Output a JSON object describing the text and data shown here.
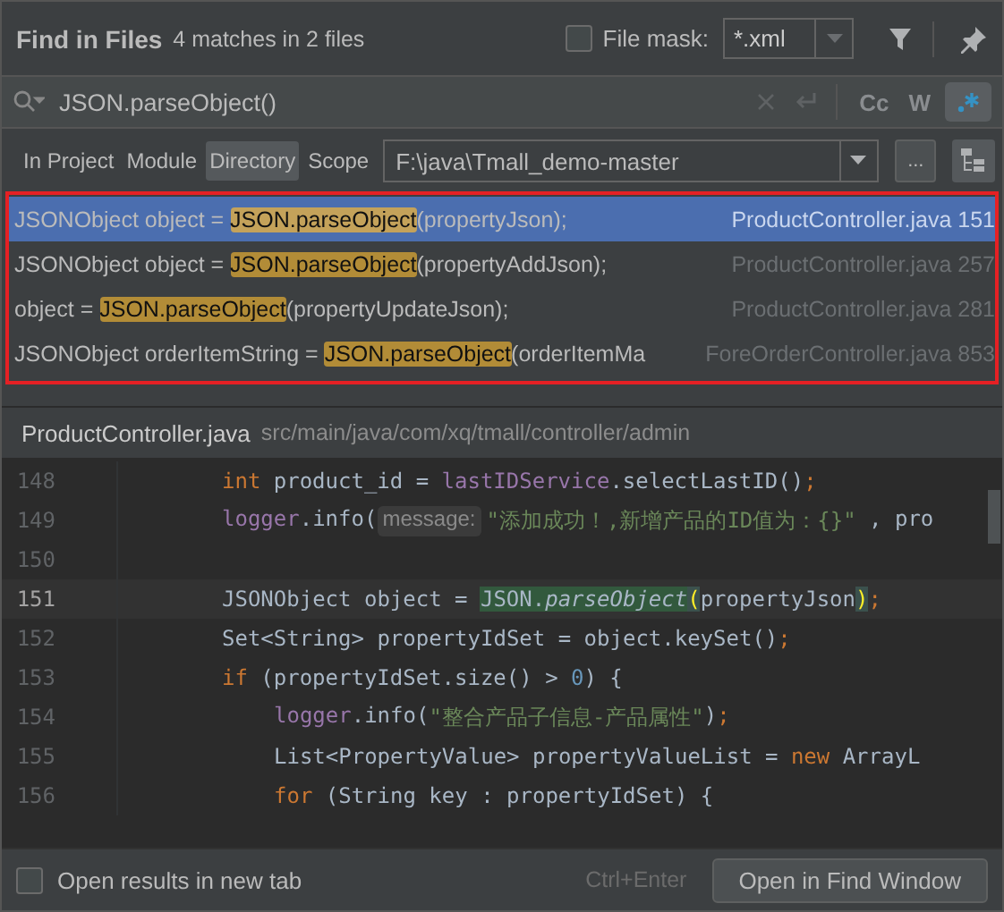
{
  "header": {
    "title": "Find in Files",
    "summary": "4 matches in 2 files",
    "file_mask": {
      "label": "File mask:",
      "checked": false,
      "value": "*.xml"
    }
  },
  "search": {
    "value": "JSON.parseObject()",
    "regex_on": true,
    "case_label": "Cc",
    "words_label": "W"
  },
  "scopes": [
    {
      "label": "In Project",
      "selected": false
    },
    {
      "label": "Module",
      "selected": false
    },
    {
      "label": "Directory",
      "selected": true
    },
    {
      "label": "Scope",
      "selected": false
    }
  ],
  "directory": {
    "value": "F:\\java\\Tmall_demo-master",
    "browse_label": "..."
  },
  "results": [
    {
      "before": "JSONObject object = ",
      "match": "JSON.parseObject",
      "after": "(propertyJson);",
      "file": "ProductController.java",
      "line": "151",
      "selected": true
    },
    {
      "before": "JSONObject object = ",
      "match": "JSON.parseObject",
      "after": "(propertyAddJson);",
      "file": "ProductController.java",
      "line": "257",
      "selected": false
    },
    {
      "before": "object = ",
      "match": "JSON.parseObject",
      "after": "(propertyUpdateJson);",
      "file": "ProductController.java",
      "line": "281",
      "selected": false
    },
    {
      "before": "JSONObject orderItemString = ",
      "match": "JSON.parseObject",
      "after": "(orderItemMa",
      "file": "ForeOrderController.java",
      "line": "853",
      "selected": false
    }
  ],
  "preview": {
    "file": "ProductController.java",
    "path": "src/main/java/com/xq/tmall/controller/admin",
    "lines": [
      {
        "number": "148",
        "current": false,
        "tokens": [
          {
            "kind": "keyword",
            "text": "int"
          },
          {
            "kind": "plain",
            "text": "product_id ="
          },
          {
            "kind": "field",
            "text": "lastIDService"
          },
          {
            "kind": "plain",
            "text": ".selectLastID()"
          },
          {
            "kind": "keyword",
            "text": ";"
          }
        ]
      },
      {
        "number": "149",
        "current": false,
        "tokens": [
          {
            "kind": "field",
            "text": "logger"
          },
          {
            "kind": "plain",
            "text": ".info("
          },
          {
            "kind": "hint",
            "text": "message:"
          },
          {
            "kind": "string",
            "text": "\"添加成功！,新增产品的ID值为：{}\""
          },
          {
            "kind": "plain",
            "text": ", pro"
          }
        ]
      },
      {
        "number": "150",
        "current": false
      },
      {
        "number": "151",
        "current": true,
        "tokens": [
          {
            "kind": "plain",
            "text": "JSONObject object ="
          },
          {
            "kind": "match",
            "text": "JSON."
          },
          {
            "kind": "match-call",
            "text": "parseObject"
          },
          {
            "kind": "brace",
            "text": "("
          },
          {
            "kind": "plain",
            "text": "propertyJson"
          },
          {
            "kind": "brace",
            "text": ")"
          },
          {
            "kind": "keyword",
            "text": ";"
          }
        ]
      },
      {
        "number": "152",
        "current": false,
        "tokens": [
          {
            "kind": "plain",
            "text": "Set<String> propertyIdSet = object.keySet()"
          },
          {
            "kind": "keyword",
            "text": ";"
          }
        ]
      },
      {
        "number": "153",
        "current": false,
        "tokens": [
          {
            "kind": "keyword",
            "text": "if"
          },
          {
            "kind": "plain",
            "text": "(propertyIdSet.size() >"
          },
          {
            "kind": "number",
            "text": "0"
          },
          {
            "kind": "plain",
            "text": ") {"
          }
        ],
        "children": [
          {
            "number": "154",
            "current": false,
            "tokens": [
              {
                "kind": "field",
                "text": "logger"
              },
              {
                "kind": "plain",
                "text": ".info("
              },
              {
                "kind": "string",
                "text": "\"整合产品子信息-产品属性\""
              },
              {
                "kind": "plain",
                "text": ")"
              },
              {
                "kind": "keyword",
                "text": ";"
              }
            ]
          },
          {
            "number": "155",
            "current": false,
            "tokens": [
              {
                "kind": "plain",
                "text": "List<PropertyValue> propertyValueList ="
              },
              {
                "kind": "keyword",
                "text": "new"
              },
              {
                "kind": "plain",
                "text": "ArrayL"
              }
            ]
          },
          {
            "number": "156",
            "current": false,
            "tokens": [
              {
                "kind": "keyword",
                "text": "for"
              },
              {
                "kind": "plain",
                "text": "(String key : propertyIdSet) {"
              }
            ]
          }
        ]
      }
    ]
  },
  "footer": {
    "new_tab": {
      "label": "Open results in new tab",
      "checked": false
    },
    "shortcut": "Ctrl+Enter",
    "open_button": "Open in Find Window"
  }
}
